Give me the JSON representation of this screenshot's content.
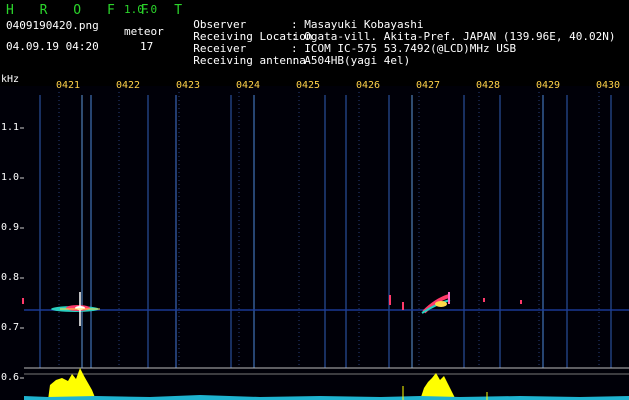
{
  "header": {
    "app_title": "H R O F F T",
    "version": "1.0.0",
    "filename": "0409190420.png",
    "meteor_label": "meteor",
    "datetime": "04.09.19 04:20",
    "meteor_count": "17"
  },
  "info": {
    "observer_label": "Observer",
    "observer_value": ": Masayuki Kobayashi",
    "location_label": "Receiving Location",
    "location_value": ": Ogata-vill. Akita-Pref. JAPAN (139.96E, 40.02N)",
    "receiver_label": "Receiver",
    "receiver_value": ": ICOM IC-575 53.7492(@LCD)MHz USB",
    "antenna_label": "Receiving antenna",
    "antenna_value": ": A504HB(yagi 4el)"
  },
  "axis": {
    "unit": "kHz",
    "y_ticks": [
      "1.1",
      "1.0",
      "0.9",
      "0.8",
      "0.7",
      "0.6"
    ],
    "x_ticks": [
      "0421",
      "0422",
      "0423",
      "0424",
      "0425",
      "0426",
      "0427",
      "0428",
      "0429",
      "0430"
    ]
  },
  "colors": {
    "title": "#2bd52b",
    "time_labels": "#ffd24a",
    "background": "#000000",
    "signal": "#4ea3ff",
    "level": "#ffff00"
  }
}
